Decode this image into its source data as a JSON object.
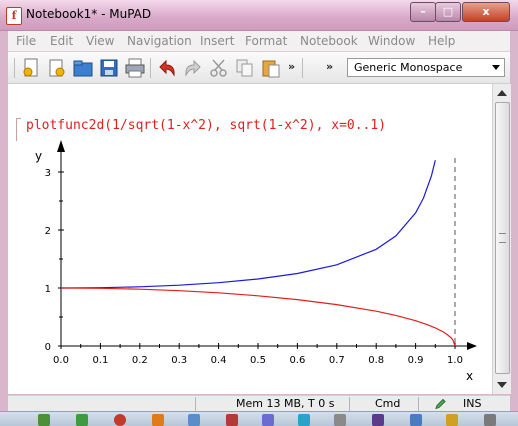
{
  "window": {
    "title": "Notebook1* - MuPAD",
    "app_icon_letter": "f",
    "controls": {
      "minimize": "–",
      "maximize": "□",
      "close": "x"
    }
  },
  "menu": [
    "File",
    "Edit",
    "View",
    "Navigation",
    "Insert",
    "Format",
    "Notebook",
    "Window",
    "Help"
  ],
  "toolbar": {
    "icons": [
      "new-notebook-icon",
      "new-from-template-icon",
      "open-folder-icon",
      "save-icon",
      "print-icon",
      "undo-icon",
      "redo-icon",
      "cut-icon",
      "copy-icon",
      "paste-icon"
    ],
    "overflow": "»",
    "font_select": "Generic Monospace"
  },
  "document": {
    "input": "plotfunc2d(1/sqrt(1-x^2), sqrt(1-x^2), x=0..1)"
  },
  "chart_data": {
    "type": "line",
    "title": "",
    "xlabel": "x",
    "ylabel": "y",
    "xlim": [
      0,
      1
    ],
    "ylim": [
      0,
      3.3
    ],
    "x_ticks": [
      "0.0",
      "0.1",
      "0.2",
      "0.3",
      "0.4",
      "0.5",
      "0.6",
      "0.7",
      "0.8",
      "0.9",
      "1.0"
    ],
    "y_ticks": [
      "0",
      "1",
      "2",
      "3"
    ],
    "vertical_asymptote": 1.0,
    "grid": false,
    "series": [
      {
        "color": "#1a1adc",
        "x": [
          0,
          0.1,
          0.2,
          0.3,
          0.4,
          0.5,
          0.6,
          0.7,
          0.8,
          0.85,
          0.9,
          0.92,
          0.94,
          0.95
        ],
        "y": [
          1,
          1.005,
          1.021,
          1.048,
          1.091,
          1.155,
          1.25,
          1.4,
          1.667,
          1.898,
          2.294,
          2.552,
          2.931,
          3.203
        ]
      },
      {
        "color": "#e0201c",
        "x": [
          0,
          0.1,
          0.2,
          0.3,
          0.4,
          0.5,
          0.6,
          0.7,
          0.8,
          0.85,
          0.9,
          0.93,
          0.95,
          0.97,
          0.98,
          0.99,
          0.995,
          1.0
        ],
        "y": [
          1,
          0.995,
          0.98,
          0.954,
          0.917,
          0.866,
          0.8,
          0.714,
          0.6,
          0.527,
          0.436,
          0.368,
          0.312,
          0.243,
          0.199,
          0.141,
          0.1,
          0
        ]
      }
    ]
  },
  "status": {
    "memory": "Mem 13 MB, T 0 s",
    "mode": "Cmd",
    "insert": "INS"
  }
}
